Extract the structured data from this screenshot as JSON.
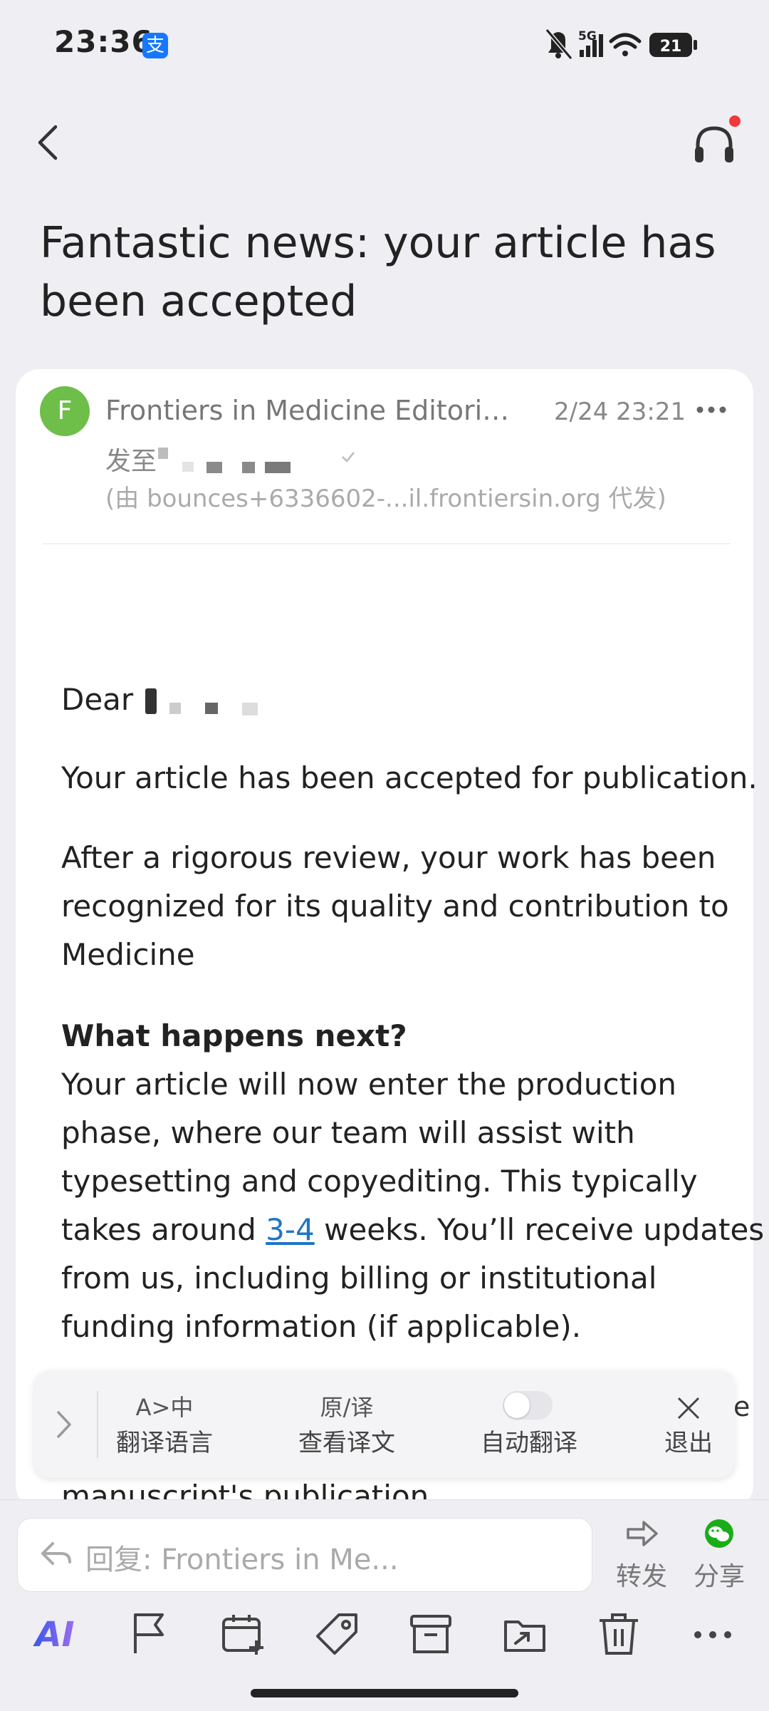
{
  "status_bar": {
    "time": "23:36",
    "alipay_glyph": "支",
    "network": "5G",
    "battery": "21"
  },
  "header": {
    "back_icon": "back-arrow-icon",
    "headset_icon": "headset-icon",
    "subject": "Fantastic news: your article has been accepted"
  },
  "message": {
    "avatar_letter": "F",
    "sender": "Frontiers in Medicine Editorial...",
    "date": "2/24 23:21",
    "to_label": "发至",
    "via": "(由 bounces+6336602-...il.frontiersin.org 代发)",
    "greeting": "Dear",
    "para1": "Your article has been accepted for publication.",
    "para2": "After a rigorous review, your work has been recognized for its quality and contribution to Medicine",
    "heading_next": "What happens next?",
    "para3_a": "Your article will now enter the production phase, where our team will assist with typesetting and copyediting. This typically takes around ",
    "para3_link": "3-4",
    "para3_b": " weeks. You’ll receive updates from us, including billing or institutional funding information (if applicable).",
    "para4_cut": "manuscript's publication",
    "para4_edge": "e"
  },
  "translate_bar": {
    "lang_top": "A>中",
    "lang_label": "翻译语言",
    "view_top": "原/译",
    "view_label": "查看译文",
    "auto_label": "自动翻译",
    "auto_enabled": false,
    "exit_label": "退出"
  },
  "reply_bar": {
    "placeholder": "回复: Frontiers in Me...",
    "forward_label": "转发",
    "share_label": "分享"
  },
  "toolbar": {
    "ai_label": "AI",
    "items": [
      "flag-icon",
      "calendar-add-icon",
      "tag-icon",
      "archive-icon",
      "move-folder-icon",
      "trash-icon",
      "more-icon"
    ]
  },
  "colors": {
    "accent_link": "#1e76c4",
    "avatar": "#6ebe4a",
    "ai_gradient_start": "#3a58e8",
    "ai_gradient_end": "#9a6cf0",
    "share_green": "#1aad19"
  }
}
